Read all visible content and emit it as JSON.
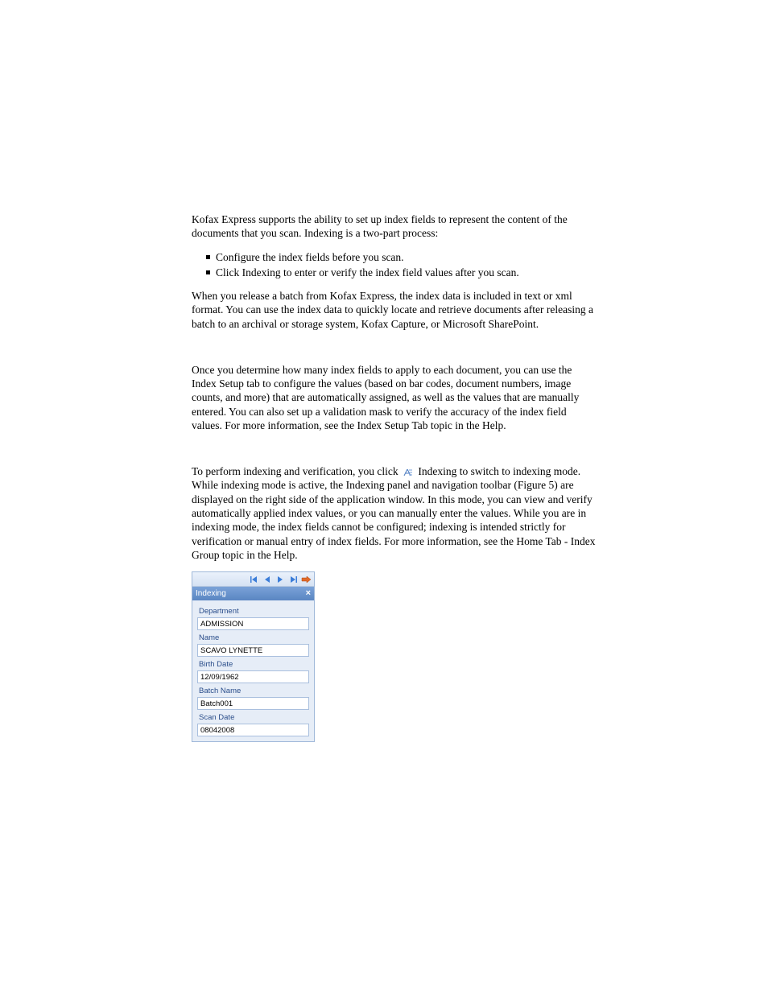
{
  "intro": "Kofax Express supports the ability to set up index fields to represent the content of the documents that you scan. Indexing is a two-part process:",
  "bullets": [
    "Configure the index fields before you scan.",
    "Click Indexing to enter or verify the index field values after you scan."
  ],
  "release_para": "When you release a batch from Kofax Express, the index data is included in text or xml format. You can use the index data to quickly locate and retrieve documents after releasing a batch to an archival or storage system, Kofax Capture, or Microsoft SharePoint.",
  "config_para": "Once you determine how many index fields to apply to each document, you can use the Index Setup tab to configure the values (based on bar codes, document numbers, image counts, and more) that are automatically assigned, as well as the values that are manually entered. You can also set up a validation mask to verify the accuracy of the index field values. For more information, see the Index Setup Tab topic in the Help.",
  "perform_para_pre": "To perform indexing and verification, you click ",
  "perform_para_post": " Indexing to switch to indexing mode. While indexing mode is active, the Indexing panel and navigation toolbar (Figure 5) are displayed on the right side of the application window. In this mode, you can view and verify automatically applied index values, or you can manually enter the values. While you are in indexing mode, the index fields cannot be configured; indexing is intended strictly for verification or manual entry of index fields. For more information, see the Home Tab - Index Group topic in the Help.",
  "panel": {
    "title": "Indexing",
    "fields": [
      {
        "label": "Department",
        "value": "ADMISSION"
      },
      {
        "label": "Name",
        "value": "SCAVO LYNETTE"
      },
      {
        "label": "Birth Date",
        "value": "12/09/1962"
      },
      {
        "label": "Batch Name",
        "value": "Batch001"
      },
      {
        "label": "Scan Date",
        "value": "08042008"
      }
    ]
  }
}
